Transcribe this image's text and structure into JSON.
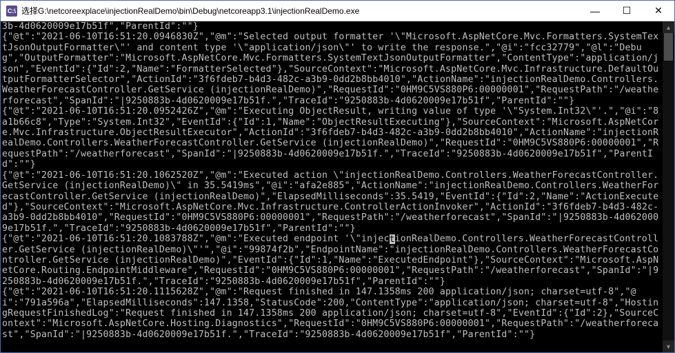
{
  "window": {
    "icon_label": "C:\\",
    "title": "选择G:\\netcoreexplace\\injectionRealDemo\\bin\\Debug\\netcoreapp3.1\\injectionRealDemo.exe"
  },
  "controls": {
    "minimize": "—",
    "maximize": "☐",
    "close": "✕"
  },
  "scrollbar": {
    "up": "▲",
    "down": "▼"
  },
  "cursor_char": "t",
  "console_pre": "3b-4d0620009e17b51f\",\"ParentId\":\"\"}\n{\"@t\":\"2021-06-10T16:51:20.0946830Z\",\"@m\":\"Selected output formatter '\\\"Microsoft.AspNetCore.Mvc.Formatters.SystemTextJsonOutputFormatter\\\"' and content type '\\\"application/json\\\"' to write the response.\",\"@i\":\"fcc32779\",\"@l\":\"Debug\",\"OutputFormatter\":\"Microsoft.AspNetCore.Mvc.Formatters.SystemTextJsonOutputFormatter\",\"ContentType\":\"application/json\",\"EventId\":{\"Id\":2,\"Name\":\"FormatterSelected\"},\"SourceContext\":\"Microsoft.AspNetCore.Mvc.Infrastructure.DefaultOutputFormatterSelector\",\"ActionId\":\"3f6fdeb7-b4d3-482c-a3b9-0dd2b8bb4010\",\"ActionName\":\"injectionRealDemo.Controllers.WeatherForecastController.GetService (injectionRealDemo)\",\"RequestId\":\"0HM9C5VS880P6:00000001\",\"RequestPath\":\"/weatherforecast\",\"SpanId\":\"|9250883b-4d0620009e17b51f.\",\"TraceId\":\"9250883b-4d0620009e17b51f\",\"ParentId\":\"\"}\n{\"@t\":\"2021-06-10T16:51:20.0952426Z\",\"@m\":\"Executing ObjectResult, writing value of type '\\\"System.Int32\\\"'.\",\"@i\":\"8a1b66c8\",\"Type\":\"System.Int32\",\"EventId\":{\"Id\":1,\"Name\":\"ObjectResultExecuting\"},\"SourceContext\":\"Microsoft.AspNetCore.Mvc.Infrastructure.ObjectResultExecutor\",\"ActionId\":\"3f6fdeb7-b4d3-482c-a3b9-0dd2b8bb4010\",\"ActionName\":\"injectionRealDemo.Controllers.WeatherForecastController.GetService (injectionRealDemo)\",\"RequestId\":\"0HM9C5VS880P6:00000001\",\"RequestPath\":\"/weatherforecast\",\"SpanId\":\"|9250883b-4d0620009e17b51f.\",\"TraceId\":\"9250883b-4d0620009e17b51f\",\"ParentId\":\"\"}\n{\"@t\":\"2021-06-10T16:51:20.1062520Z\",\"@m\":\"Executed action \\\"injectionRealDemo.Controllers.WeatherForecastController.GetService (injectionRealDemo)\\\" in 35.5419ms\",\"@i\":\"afa2e885\",\"ActionName\":\"injectionRealDemo.Controllers.WeatherForecastController.GetService (injectionRealDemo)\",\"ElapsedMilliseconds\":35.5419,\"EventId\":{\"Id\":2,\"Name\":\"ActionExecuted\"},\"SourceContext\":\"Microsoft.AspNetCore.Mvc.Infrastructure.ControllerActionInvoker\",\"ActionId\":\"3f6fdeb7-b4d3-482c-a3b9-0dd2b8bb4010\",\"RequestId\":\"0HM9C5VS880P6:00000001\",\"RequestPath\":\"/weatherforecast\",\"SpanId\":\"|9250883b-4d0620009e17b51f.\",\"TraceId\":\"9250883b-4d0620009e17b51f\",\"ParentId\":\"\"}\n{\"@t\":\"2021-06-10T16:51:20.1083788Z\",\"@m\":\"Executed endpoint '\\\"injec",
  "console_post": "ionRealDemo.Controllers.WeatherForecastController.GetService (injectionRealDemo)\\\"'\",\"@i\":\"99874f2b\",\"EndpointName\":\"injectionRealDemo.Controllers.WeatherForecastController.GetService (injectionRealDemo)\",\"EventId\":{\"Id\":1,\"Name\":\"ExecutedEndpoint\"},\"SourceContext\":\"Microsoft.AspNetCore.Routing.EndpointMiddleware\",\"RequestId\":\"0HM9C5VS880P6:00000001\",\"RequestPath\":\"/weatherforecast\",\"SpanId\":\"|9250883b-4d0620009e17b51f.\",\"TraceId\":\"9250883b-4d0620009e17b51f\",\"ParentId\":\"\"}\n{\"@t\":\"2021-06-10T16:51:20.1115628Z\",\"@m\":\"Request finished in 147.1358ms 200 application/json; charset=utf-8\",\"@i\":\"791a596a\",\"ElapsedMilliseconds\":147.1358,\"StatusCode\":200,\"ContentType\":\"application/json; charset=utf-8\",\"HostingRequestFinishedLog\":\"Request finished in 147.1358ms 200 application/json; charset=utf-8\",\"EventId\":{\"Id\":2},\"SourceContext\":\"Microsoft.AspNetCore.Hosting.Diagnostics\",\"RequestId\":\"0HM9C5VS880P6:00000001\",\"RequestPath\":\"/weatherforecast\",\"SpanId\":\"|9250883b-4d0620009e17b51f.\",\"TraceId\":\"9250883b-4d0620009e17b51f\",\"ParentId\":\"\"}"
}
